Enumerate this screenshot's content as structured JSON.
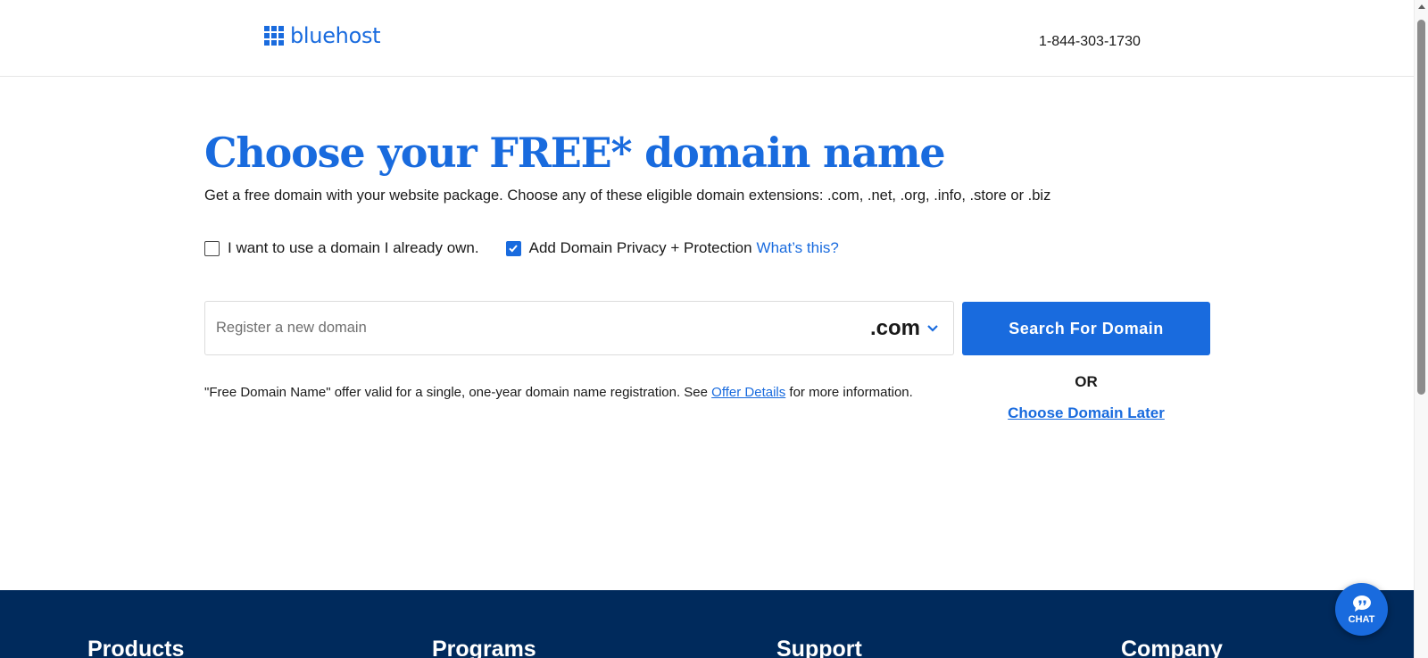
{
  "header": {
    "logo_text": "bluehost",
    "logo_icon": "grid-icon",
    "phone": "1-844-303-1730"
  },
  "main": {
    "title": "Choose your FREE* domain name",
    "subtitle": "Get a free domain with your website package. Choose any of these eligible domain extensions: .com, .net, .org, .info, .store or .biz",
    "own_domain_label": "I want to use a domain I already own.",
    "own_domain_checked": false,
    "privacy_label": "Add Domain Privacy + Protection",
    "privacy_checked": true,
    "privacy_link": "What’s this?",
    "domain_placeholder": "Register a new domain",
    "tld_selected": ".com",
    "search_button": "Search For Domain",
    "disclaimer_before": "\"Free Domain Name\" offer valid for a single, one-year domain name registration. See ",
    "disclaimer_link": "Offer Details",
    "disclaimer_after": " for more information.",
    "or_label": "OR",
    "choose_later": "Choose Domain Later"
  },
  "footer": {
    "columns": [
      "Products",
      "Programs",
      "Support",
      "Company"
    ]
  },
  "chat": {
    "label": "CHAT",
    "icon": "chat-bubble-icon"
  },
  "colors": {
    "brand_blue": "#196bde",
    "footer_navy": "#002a5c"
  }
}
